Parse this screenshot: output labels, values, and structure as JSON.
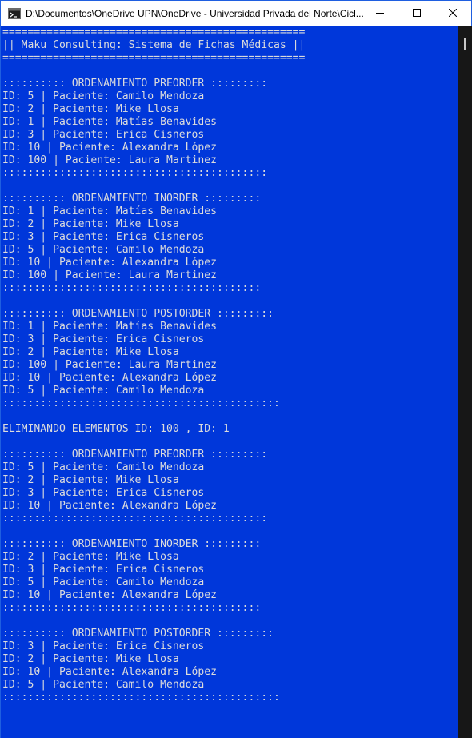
{
  "window": {
    "title": "D:\\Documentos\\OneDrive UPN\\OneDrive - Universidad Privada del Norte\\Cicl...",
    "icons": {
      "app": "terminal-icon",
      "minimize": "minimize-icon",
      "maximize": "maximize-icon",
      "close": "close-icon"
    }
  },
  "colors": {
    "console_bg": "#0037da",
    "console_fg": "#dcdcdc",
    "titlebar_bg": "#ffffff",
    "scrollbar_bg": "#171717"
  },
  "console": {
    "lines": [
      "================================================",
      "|| Maku Consulting: Sistema de Fichas Médicas ||",
      "================================================",
      "",
      ":::::::::: ORDENAMIENTO PREORDER :::::::::",
      "ID: 5 | Paciente: Camilo Mendoza",
      "ID: 2 | Paciente: Mike Llosa",
      "ID: 1 | Paciente: Matías Benavides",
      "ID: 3 | Paciente: Erica Cisneros",
      "ID: 10 | Paciente: Alexandra López",
      "ID: 100 | Paciente: Laura Martinez",
      "::::::::::::::::::::::::::::::::::::::::::",
      "",
      ":::::::::: ORDENAMIENTO INORDER :::::::::",
      "ID: 1 | Paciente: Matías Benavides",
      "ID: 2 | Paciente: Mike Llosa",
      "ID: 3 | Paciente: Erica Cisneros",
      "ID: 5 | Paciente: Camilo Mendoza",
      "ID: 10 | Paciente: Alexandra López",
      "ID: 100 | Paciente: Laura Martinez",
      ":::::::::::::::::::::::::::::::::::::::::",
      "",
      ":::::::::: ORDENAMIENTO POSTORDER :::::::::",
      "ID: 1 | Paciente: Matías Benavides",
      "ID: 3 | Paciente: Erica Cisneros",
      "ID: 2 | Paciente: Mike Llosa",
      "ID: 100 | Paciente: Laura Martinez",
      "ID: 10 | Paciente: Alexandra López",
      "ID: 5 | Paciente: Camilo Mendoza",
      "::::::::::::::::::::::::::::::::::::::::::::",
      "",
      "ELIMINANDO ELEMENTOS ID: 100 , ID: 1",
      "",
      ":::::::::: ORDENAMIENTO PREORDER :::::::::",
      "ID: 5 | Paciente: Camilo Mendoza",
      "ID: 2 | Paciente: Mike Llosa",
      "ID: 3 | Paciente: Erica Cisneros",
      "ID: 10 | Paciente: Alexandra López",
      "::::::::::::::::::::::::::::::::::::::::::",
      "",
      ":::::::::: ORDENAMIENTO INORDER :::::::::",
      "ID: 2 | Paciente: Mike Llosa",
      "ID: 3 | Paciente: Erica Cisneros",
      "ID: 5 | Paciente: Camilo Mendoza",
      "ID: 10 | Paciente: Alexandra López",
      ":::::::::::::::::::::::::::::::::::::::::",
      "",
      ":::::::::: ORDENAMIENTO POSTORDER :::::::::",
      "ID: 3 | Paciente: Erica Cisneros",
      "ID: 2 | Paciente: Mike Llosa",
      "ID: 10 | Paciente: Alexandra López",
      "ID: 5 | Paciente: Camilo Mendoza",
      "::::::::::::::::::::::::::::::::::::::::::::"
    ]
  }
}
